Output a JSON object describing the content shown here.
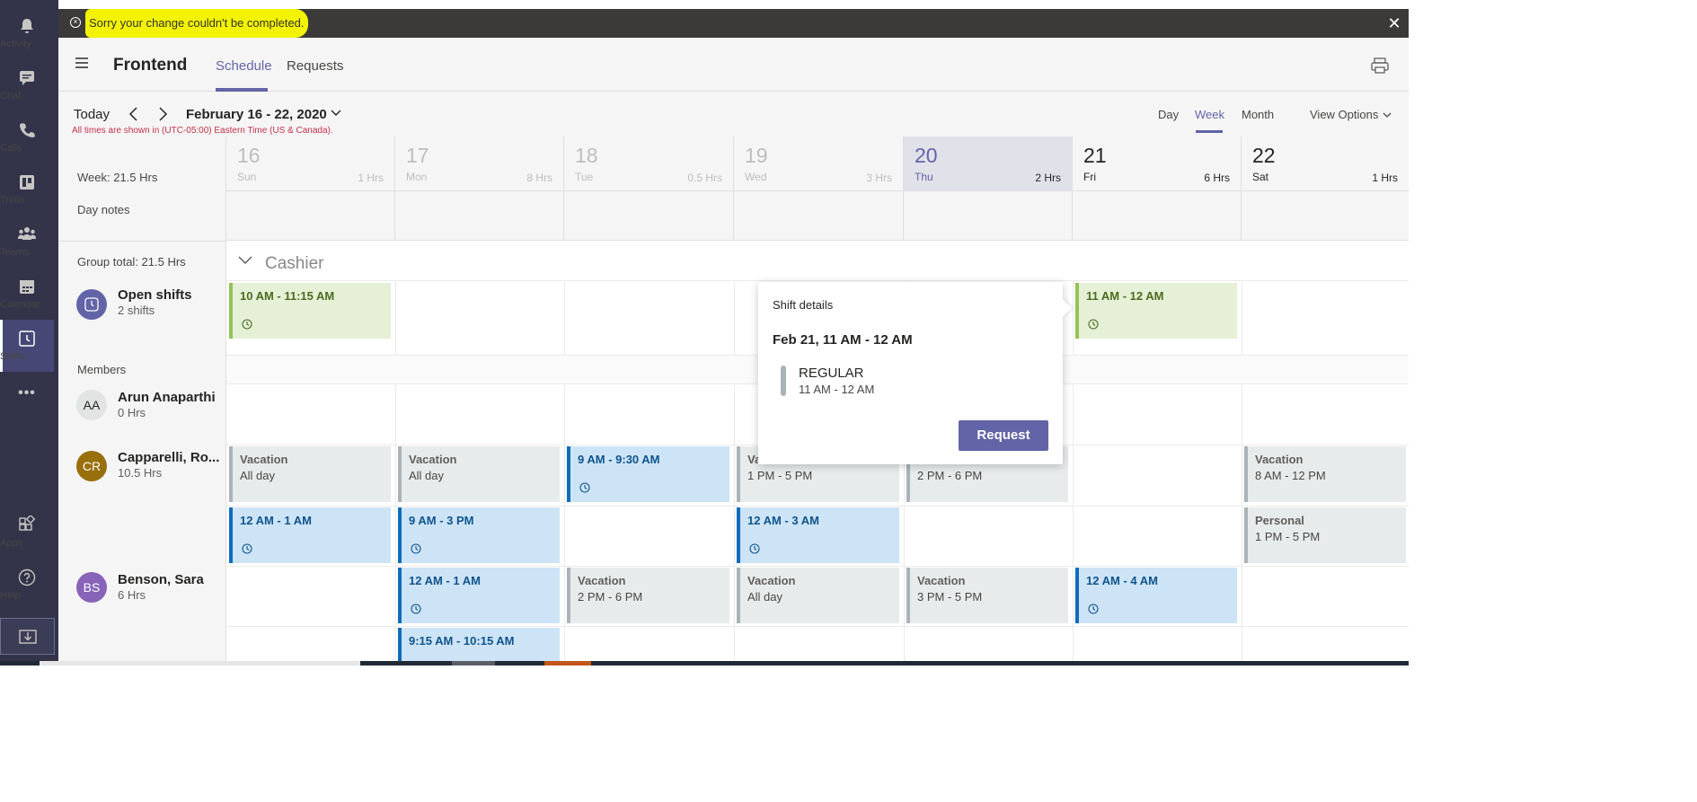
{
  "rail": {
    "items": [
      {
        "label": "Activity",
        "icon": "bell-icon"
      },
      {
        "label": "Chat",
        "icon": "chat-icon"
      },
      {
        "label": "Calls",
        "icon": "phone-icon"
      },
      {
        "label": "Trello",
        "icon": "trello-icon"
      },
      {
        "label": "Teams",
        "icon": "teams-icon"
      },
      {
        "label": "Calendar",
        "icon": "calendar-icon"
      },
      {
        "label": "Shifts",
        "icon": "shifts-icon"
      }
    ],
    "more": "•••",
    "bottom": [
      {
        "label": "Apps",
        "icon": "apps-icon"
      },
      {
        "label": "Help",
        "icon": "help-icon"
      }
    ]
  },
  "banner": {
    "message": "Sorry your change couldn't be completed.",
    "close": "✕"
  },
  "header": {
    "title": "Frontend",
    "tabs": [
      "Schedule",
      "Requests"
    ]
  },
  "toolbar": {
    "today": "Today",
    "date_range": "February 16 - 22, 2020",
    "timezone_note": "All times are shown in (UTC-05:00) Eastern Time (US & Canada).",
    "views": [
      "Day",
      "Week",
      "Month"
    ],
    "view_options": "View Options"
  },
  "leftcol": {
    "week_total": "Week: 21.5 Hrs",
    "day_notes": "Day notes",
    "group_total": "Group total: 21.5 Hrs",
    "open_shifts": {
      "name": "Open shifts",
      "sub": "2 shifts"
    },
    "members_label": "Members",
    "members": [
      {
        "initials": "AA",
        "name": "Arun Anaparthi",
        "hours": "0 Hrs",
        "color": "#e5e7ea"
      },
      {
        "initials": "CR",
        "name": "Capparelli, Ro...",
        "hours": "10.5 Hrs",
        "color": "#986f0b"
      },
      {
        "initials": "BS",
        "name": "Benson, Sara",
        "hours": "6 Hrs",
        "color": "#8764b8"
      }
    ]
  },
  "days": [
    {
      "num": "16",
      "name": "Sun",
      "hrs": "1 Hrs"
    },
    {
      "num": "17",
      "name": "Mon",
      "hrs": "8 Hrs"
    },
    {
      "num": "18",
      "name": "Tue",
      "hrs": "0.5 Hrs"
    },
    {
      "num": "19",
      "name": "Wed",
      "hrs": "3 Hrs"
    },
    {
      "num": "20",
      "name": "Thu",
      "hrs": "2 Hrs"
    },
    {
      "num": "21",
      "name": "Fri",
      "hrs": "6 Hrs"
    },
    {
      "num": "22",
      "name": "Sat",
      "hrs": "1 Hrs"
    }
  ],
  "group": {
    "name": "Cashier"
  },
  "shifts": {
    "open_sun": {
      "time": "10 AM - 11:15 AM"
    },
    "open_fri": {
      "time": "11 AM - 12 AM"
    },
    "cr_sun_1": {
      "title": "Vacation",
      "sub": "All day"
    },
    "cr_mon_1": {
      "title": "Vacation",
      "sub": "All day"
    },
    "cr_tue_1": {
      "time": "9 AM - 9:30 AM"
    },
    "cr_wed_1": {
      "title": "Va",
      "sub": "1 PM - 5 PM"
    },
    "cr_thu_1": {
      "sub": "2 PM - 6 PM"
    },
    "cr_sat_1": {
      "title": "Vacation",
      "sub": "8 AM - 12 PM"
    },
    "cr_sun_2": {
      "time": "12 AM - 1 AM"
    },
    "cr_mon_2": {
      "time": "9 AM - 3 PM"
    },
    "cr_wed_2": {
      "time": "12 AM - 3 AM"
    },
    "cr_sat_2": {
      "title": "Personal",
      "sub": "1 PM - 5 PM"
    },
    "bs_mon_1": {
      "time": "12 AM - 1 AM"
    },
    "bs_tue_1": {
      "title": "Vacation",
      "sub": "2 PM - 6 PM"
    },
    "bs_wed_1": {
      "title": "Vacation",
      "sub": "All day"
    },
    "bs_thu_1": {
      "title": "Vacation",
      "sub": "3 PM - 5 PM"
    },
    "bs_fri_1": {
      "time": "12 AM - 4 AM"
    },
    "bs_mon_2": {
      "time": "9:15 AM - 10:15 AM"
    }
  },
  "popover": {
    "title": "Shift details",
    "date": "Feb 21, 11 AM - 12 AM",
    "type": "REGULAR",
    "time": "11 AM - 12 AM",
    "button": "Request"
  },
  "colors": {
    "accent": "#6264a7",
    "rail": "#33344a",
    "banner": "#3b3a39",
    "highlight": "#f3f300",
    "error": "#c4314b"
  }
}
